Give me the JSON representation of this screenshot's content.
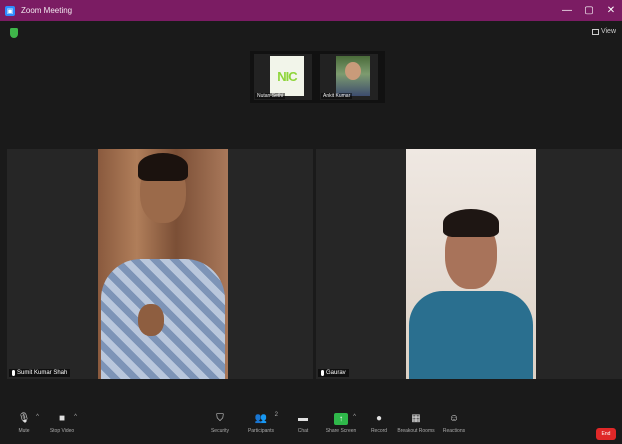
{
  "window": {
    "title": "Zoom Meeting",
    "minimize": "—",
    "maximize": "▢",
    "close": "✕"
  },
  "top": {
    "view_label": "View"
  },
  "thumbnails": [
    {
      "logo_text": "NIC",
      "name": "Nutan Sethi"
    },
    {
      "name": "Ankit Kumar"
    }
  ],
  "speakers": [
    {
      "name": "Sumit Kumar Shah"
    },
    {
      "name": "Gaurav"
    }
  ],
  "toolbar": {
    "mute": "Mute",
    "stop_video": "Stop Video",
    "security": "Security",
    "participants": "Participants",
    "participants_count": "2",
    "chat": "Chat",
    "share_screen": "Share Screen",
    "record": "Record",
    "breakout": "Breakout Rooms",
    "reactions": "Reactions",
    "end": "End"
  },
  "colors": {
    "titlebar": "#7b1c63",
    "share_green": "#2fb84a",
    "end_red": "#e02828"
  }
}
